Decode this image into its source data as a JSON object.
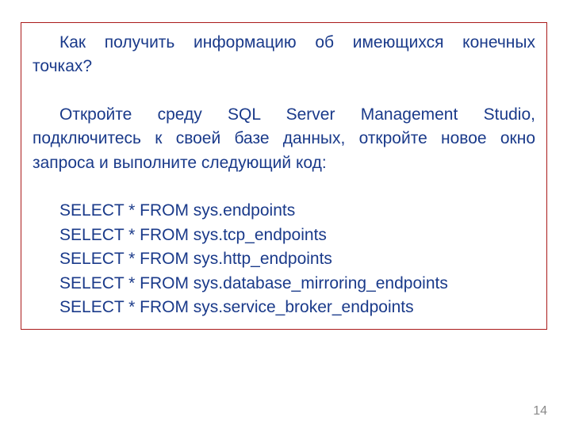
{
  "para1_line1": "Как получить информацию об имеющихся конечных",
  "para1_line2": "точках?",
  "para2": "Откройте среду SQL Server Management Studio, подключитесь к своей базе данных, откройте новое окно запроса и выполните следующий код:",
  "code": {
    "l1": "SELECT * FROM sys.endpoints",
    "l2": "SELECT * FROM sys.tcp_endpoints",
    "l3": "SELECT * FROM sys.http_endpoints",
    "l4": "SELECT * FROM sys.database_mirroring_endpoints",
    "l5": "SELECT * FROM sys.service_broker_endpoints"
  },
  "page_number": "14"
}
